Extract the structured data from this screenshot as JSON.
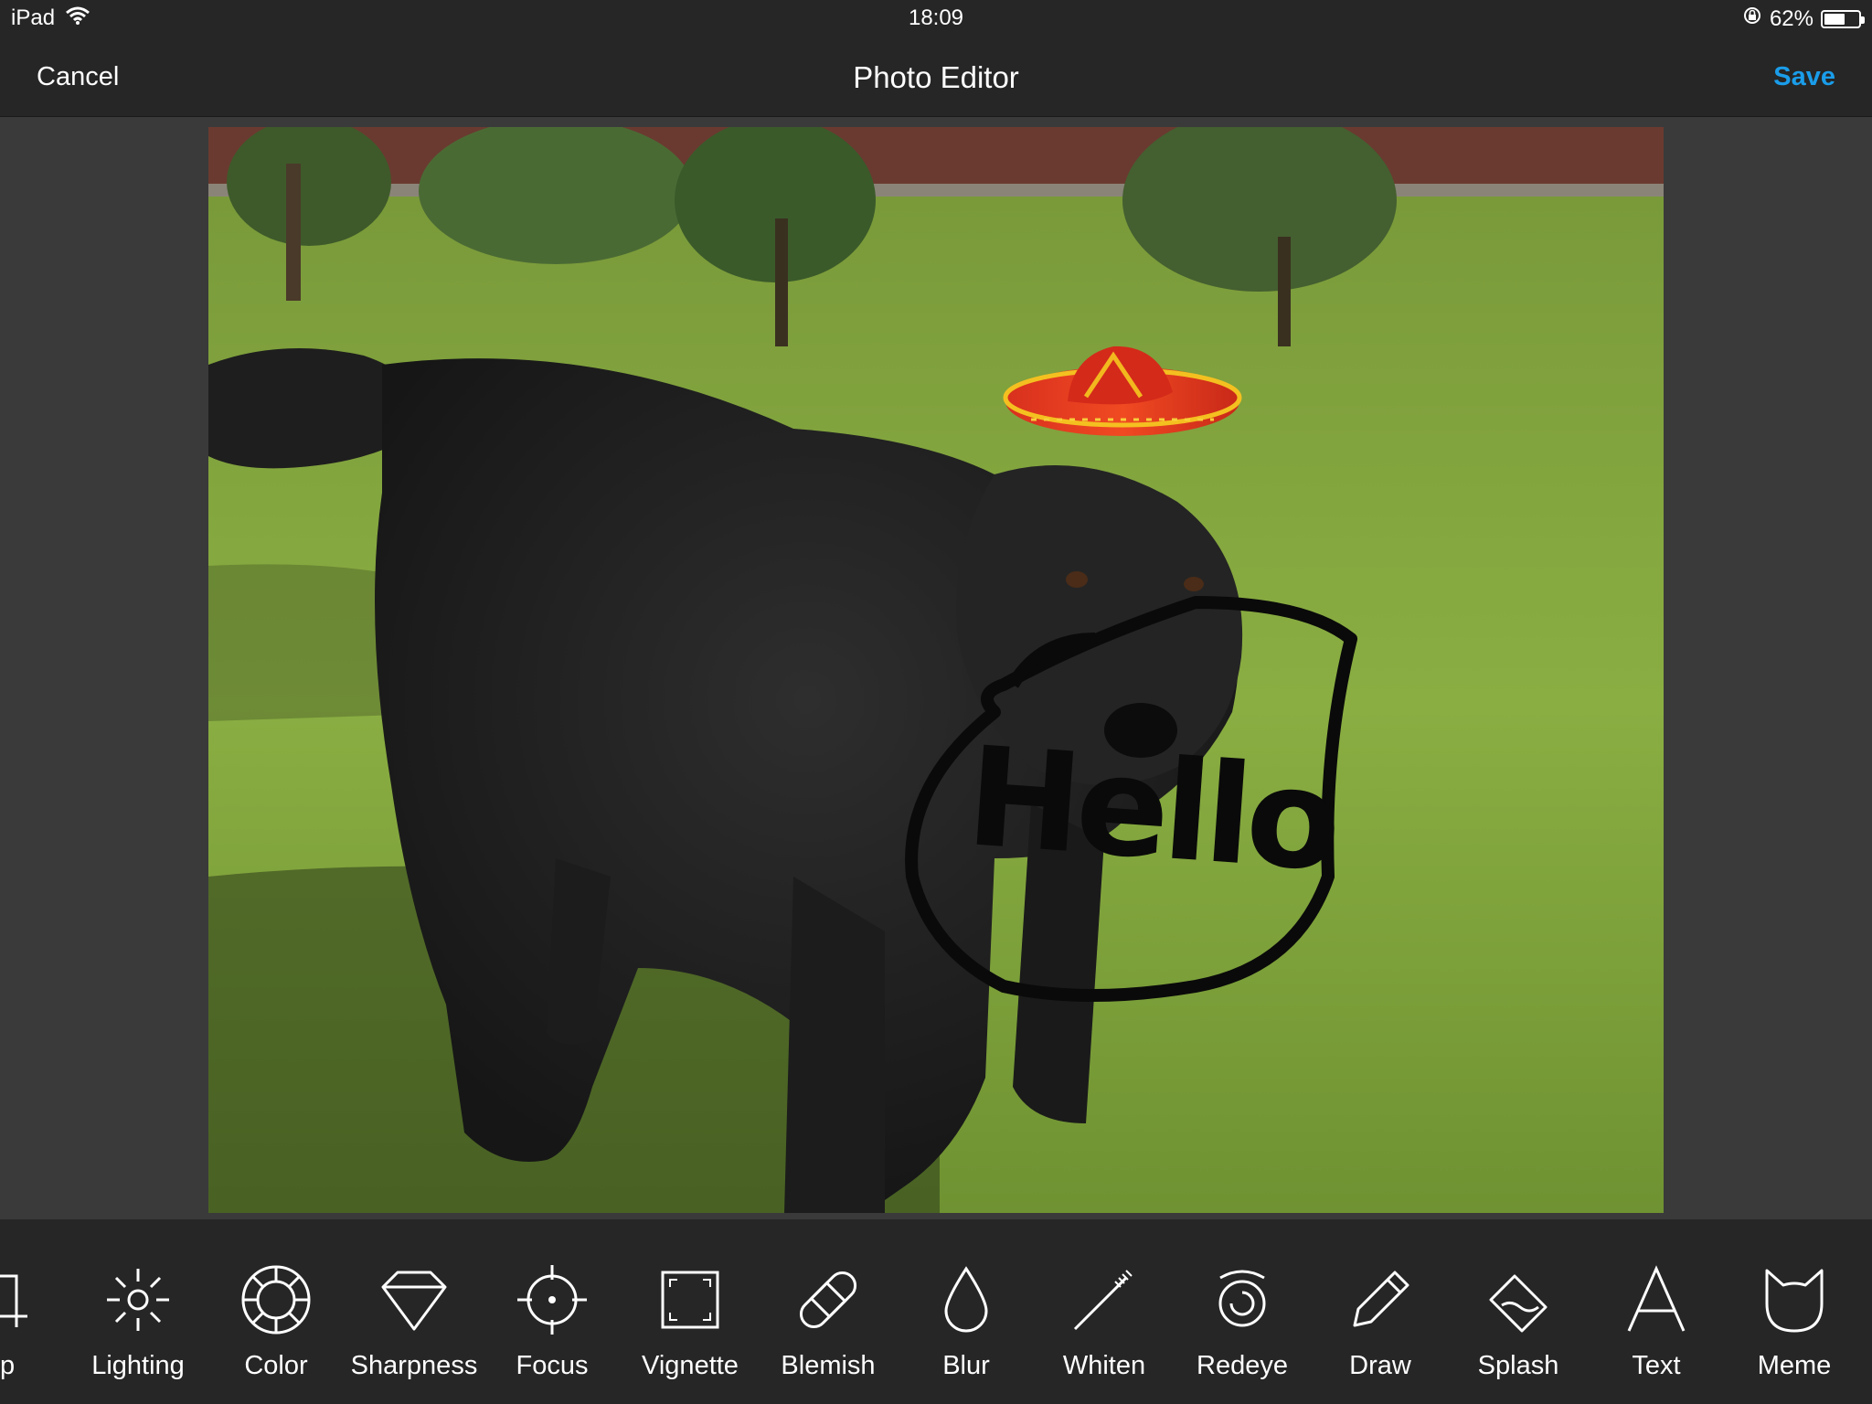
{
  "status_bar": {
    "device": "iPad",
    "time": "18:09",
    "battery_percent": "62%",
    "battery_level": 0.62
  },
  "nav": {
    "cancel_label": "Cancel",
    "title": "Photo Editor",
    "save_label": "Save"
  },
  "colors": {
    "accent": "#1a9dea",
    "bar_background": "#262626",
    "canvas_background": "#3a3a3a"
  },
  "photo": {
    "drawn_text": "Hello"
  },
  "tools": [
    {
      "label": "op",
      "icon": "crop-icon"
    },
    {
      "label": "Lighting",
      "icon": "sun-icon"
    },
    {
      "label": "Color",
      "icon": "color-wheel-icon"
    },
    {
      "label": "Sharpness",
      "icon": "diamond-icon"
    },
    {
      "label": "Focus",
      "icon": "crosshair-icon"
    },
    {
      "label": "Vignette",
      "icon": "vignette-icon"
    },
    {
      "label": "Blemish",
      "icon": "bandage-icon"
    },
    {
      "label": "Blur",
      "icon": "drop-icon"
    },
    {
      "label": "Whiten",
      "icon": "toothbrush-icon"
    },
    {
      "label": "Redeye",
      "icon": "eye-icon"
    },
    {
      "label": "Draw",
      "icon": "pencil-icon"
    },
    {
      "label": "Splash",
      "icon": "eraser-icon"
    },
    {
      "label": "Text",
      "icon": "letter-a-icon"
    },
    {
      "label": "Meme",
      "icon": "cat-icon"
    }
  ]
}
